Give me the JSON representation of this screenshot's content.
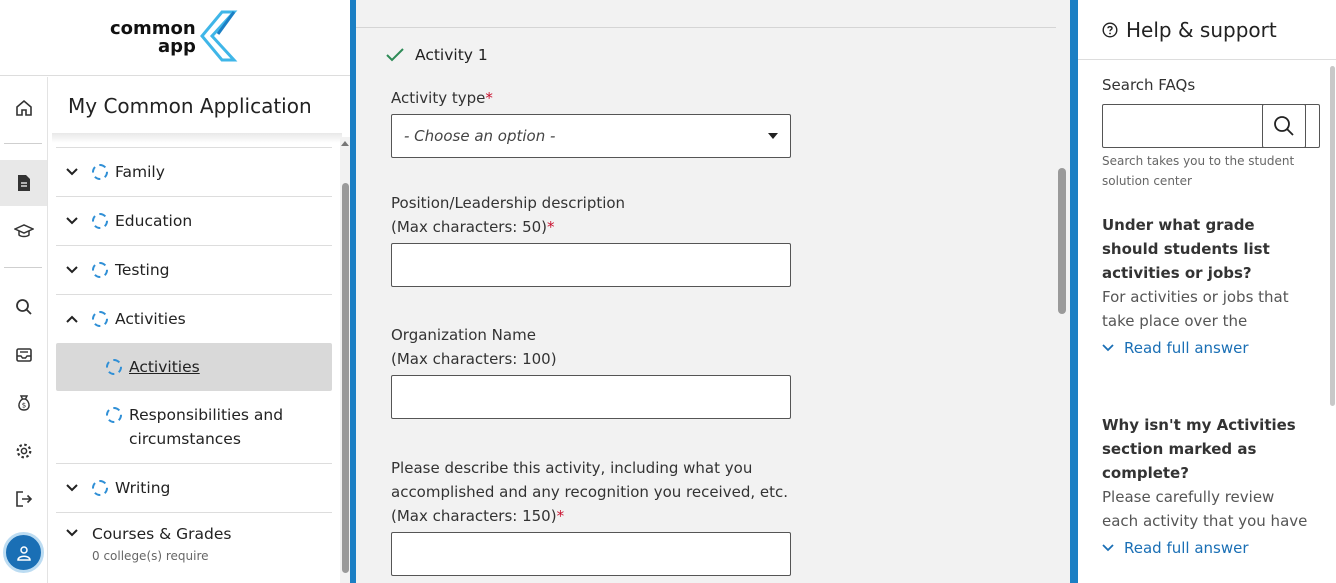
{
  "app": {
    "logo_line1": "common",
    "logo_line2": "app"
  },
  "rail": {
    "items": [
      {
        "icon": "home-icon"
      },
      {
        "icon": "document-icon",
        "active": true
      },
      {
        "icon": "graduation-cap-icon"
      },
      {
        "icon": "search-icon"
      },
      {
        "icon": "inbox-icon"
      },
      {
        "icon": "money-bag-icon"
      },
      {
        "icon": "gear-icon"
      },
      {
        "icon": "sign-out-icon"
      }
    ],
    "avatar_icon": "user-icon"
  },
  "nav": {
    "title": "My Common Application",
    "sections": [
      {
        "label": "Family",
        "expanded": false
      },
      {
        "label": "Education",
        "expanded": false
      },
      {
        "label": "Testing",
        "expanded": false
      },
      {
        "label": "Activities",
        "expanded": true
      },
      {
        "label": "Writing",
        "expanded": false
      },
      {
        "label": "Courses & Grades",
        "expanded": false,
        "sublabel": "0 college(s) require"
      }
    ],
    "activities_subitems": [
      {
        "label": "Activities",
        "active": true
      },
      {
        "label": "Responsibilities and circumstances",
        "active": false
      }
    ]
  },
  "form": {
    "activity_header": "Activity 1",
    "activity_type_label": "Activity type",
    "activity_type_value": "- Choose an option -",
    "position_label_line1": "Position/Leadership description",
    "position_label_line2": "(Max characters: 50)",
    "org_label_line1": "Organization Name",
    "org_label_line2": "(Max characters: 100)",
    "describe_label_line1": "Please describe this activity, including what you",
    "describe_label_line2": "accomplished and any recognition you received, etc.",
    "describe_label_line3": "(Max characters: 150)",
    "required_mark": "*"
  },
  "help": {
    "title": "Help & support",
    "search_label": "Search FAQs",
    "search_value": "",
    "search_hint": "Search takes you to the student solution center",
    "faqs": [
      {
        "question": "Under what grade should students list activities or jobs?",
        "answer_preview": "For activities or jobs that take place over the summe...",
        "read_more": "Read full answer"
      },
      {
        "question": "Why isn't my Activities section marked as complete?",
        "answer_preview": "Please carefully review each activity that you have liste...",
        "read_more": "Read full answer"
      }
    ]
  },
  "colors": {
    "accent_blue": "#1b7fc4",
    "link_blue": "#1a6fb5",
    "required_red": "#c8102e",
    "check_green": "#2e8b57",
    "form_bg": "#f2f2f2"
  }
}
